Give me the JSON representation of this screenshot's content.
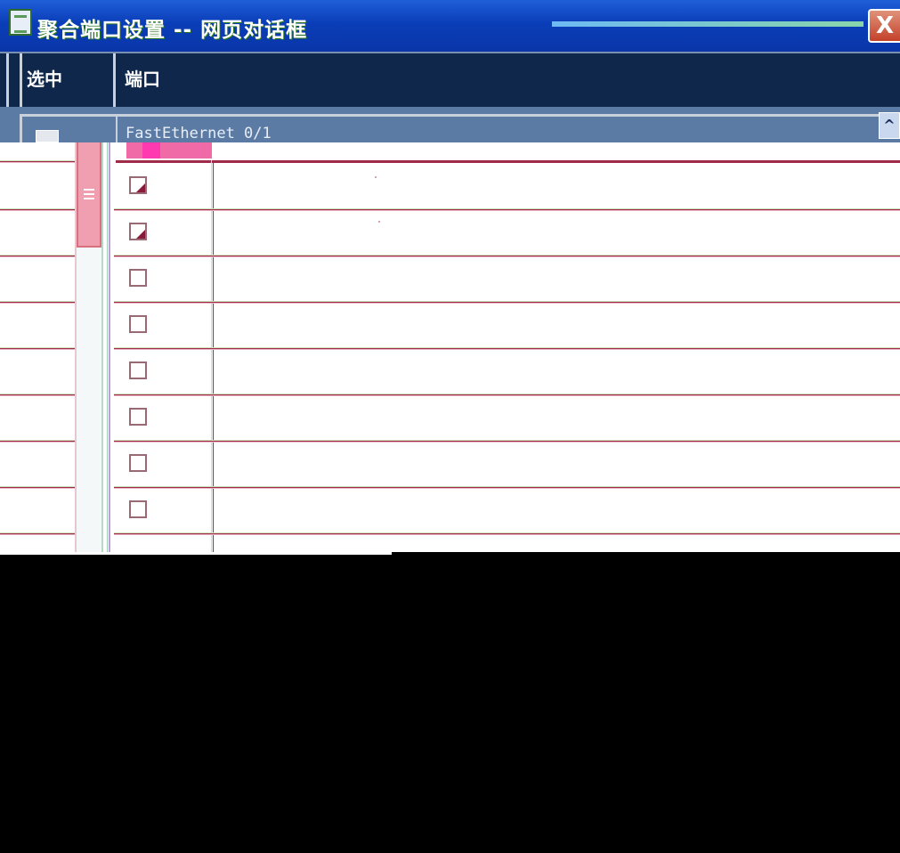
{
  "window": {
    "title": "聚合端口设置 -- 网页对话框",
    "close_symbol": "X"
  },
  "table": {
    "columns": [
      "选中",
      "端口"
    ],
    "first_row": {
      "checked": false,
      "port": "FastEthernet 0/1"
    },
    "scroll_up_symbol": "^",
    "rows": [
      {
        "checked": false,
        "port": ""
      },
      {
        "checked": false,
        "port": ""
      },
      {
        "checked": false,
        "port": ""
      },
      {
        "checked": false,
        "port": ""
      },
      {
        "checked": false,
        "port": ""
      },
      {
        "checked": false,
        "port": ""
      },
      {
        "checked": false,
        "port": ""
      },
      {
        "checked": false,
        "port": ""
      }
    ]
  },
  "colors": {
    "titlebar": "#0a3db8",
    "header": "#0e274a",
    "selected_row": "#5b7ba5",
    "scroll_thumb": "#ef9fb0",
    "row_line": "#a02a4a"
  }
}
